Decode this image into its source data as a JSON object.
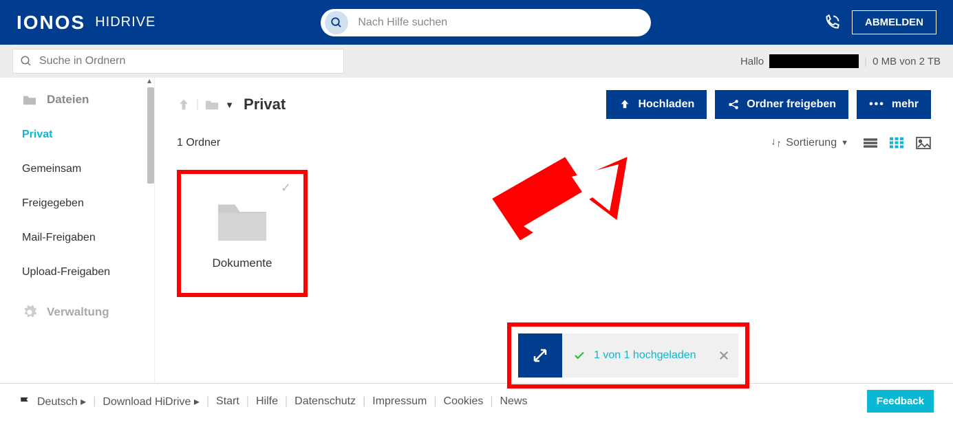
{
  "header": {
    "logo_main": "IONOS",
    "logo_sub": "HIDRIVE",
    "search_placeholder": "Nach Hilfe suchen",
    "logout": "ABMELDEN"
  },
  "subheader": {
    "folder_search_placeholder": "Suche in Ordnern",
    "greeting": "Hallo",
    "storage": "0 MB von 2 TB"
  },
  "sidebar": {
    "section_files": "Dateien",
    "items": [
      "Privat",
      "Gemeinsam",
      "Freigegeben",
      "Mail-Freigaben",
      "Upload-Freigaben"
    ],
    "section_admin": "Verwaltung"
  },
  "content": {
    "breadcrumb_current": "Privat",
    "upload_btn": "Hochladen",
    "share_btn": "Ordner freigeben",
    "more_btn": "mehr",
    "folder_count": "1 Ordner",
    "sort_label": "Sortierung",
    "folder_name": "Dokumente",
    "upload_toast": "1 von 1 hochgeladen"
  },
  "footer": {
    "language": "Deutsch",
    "download": "Download HiDrive",
    "links": [
      "Start",
      "Hilfe",
      "Datenschutz",
      "Impressum",
      "Cookies",
      "News"
    ],
    "feedback": "Feedback"
  }
}
